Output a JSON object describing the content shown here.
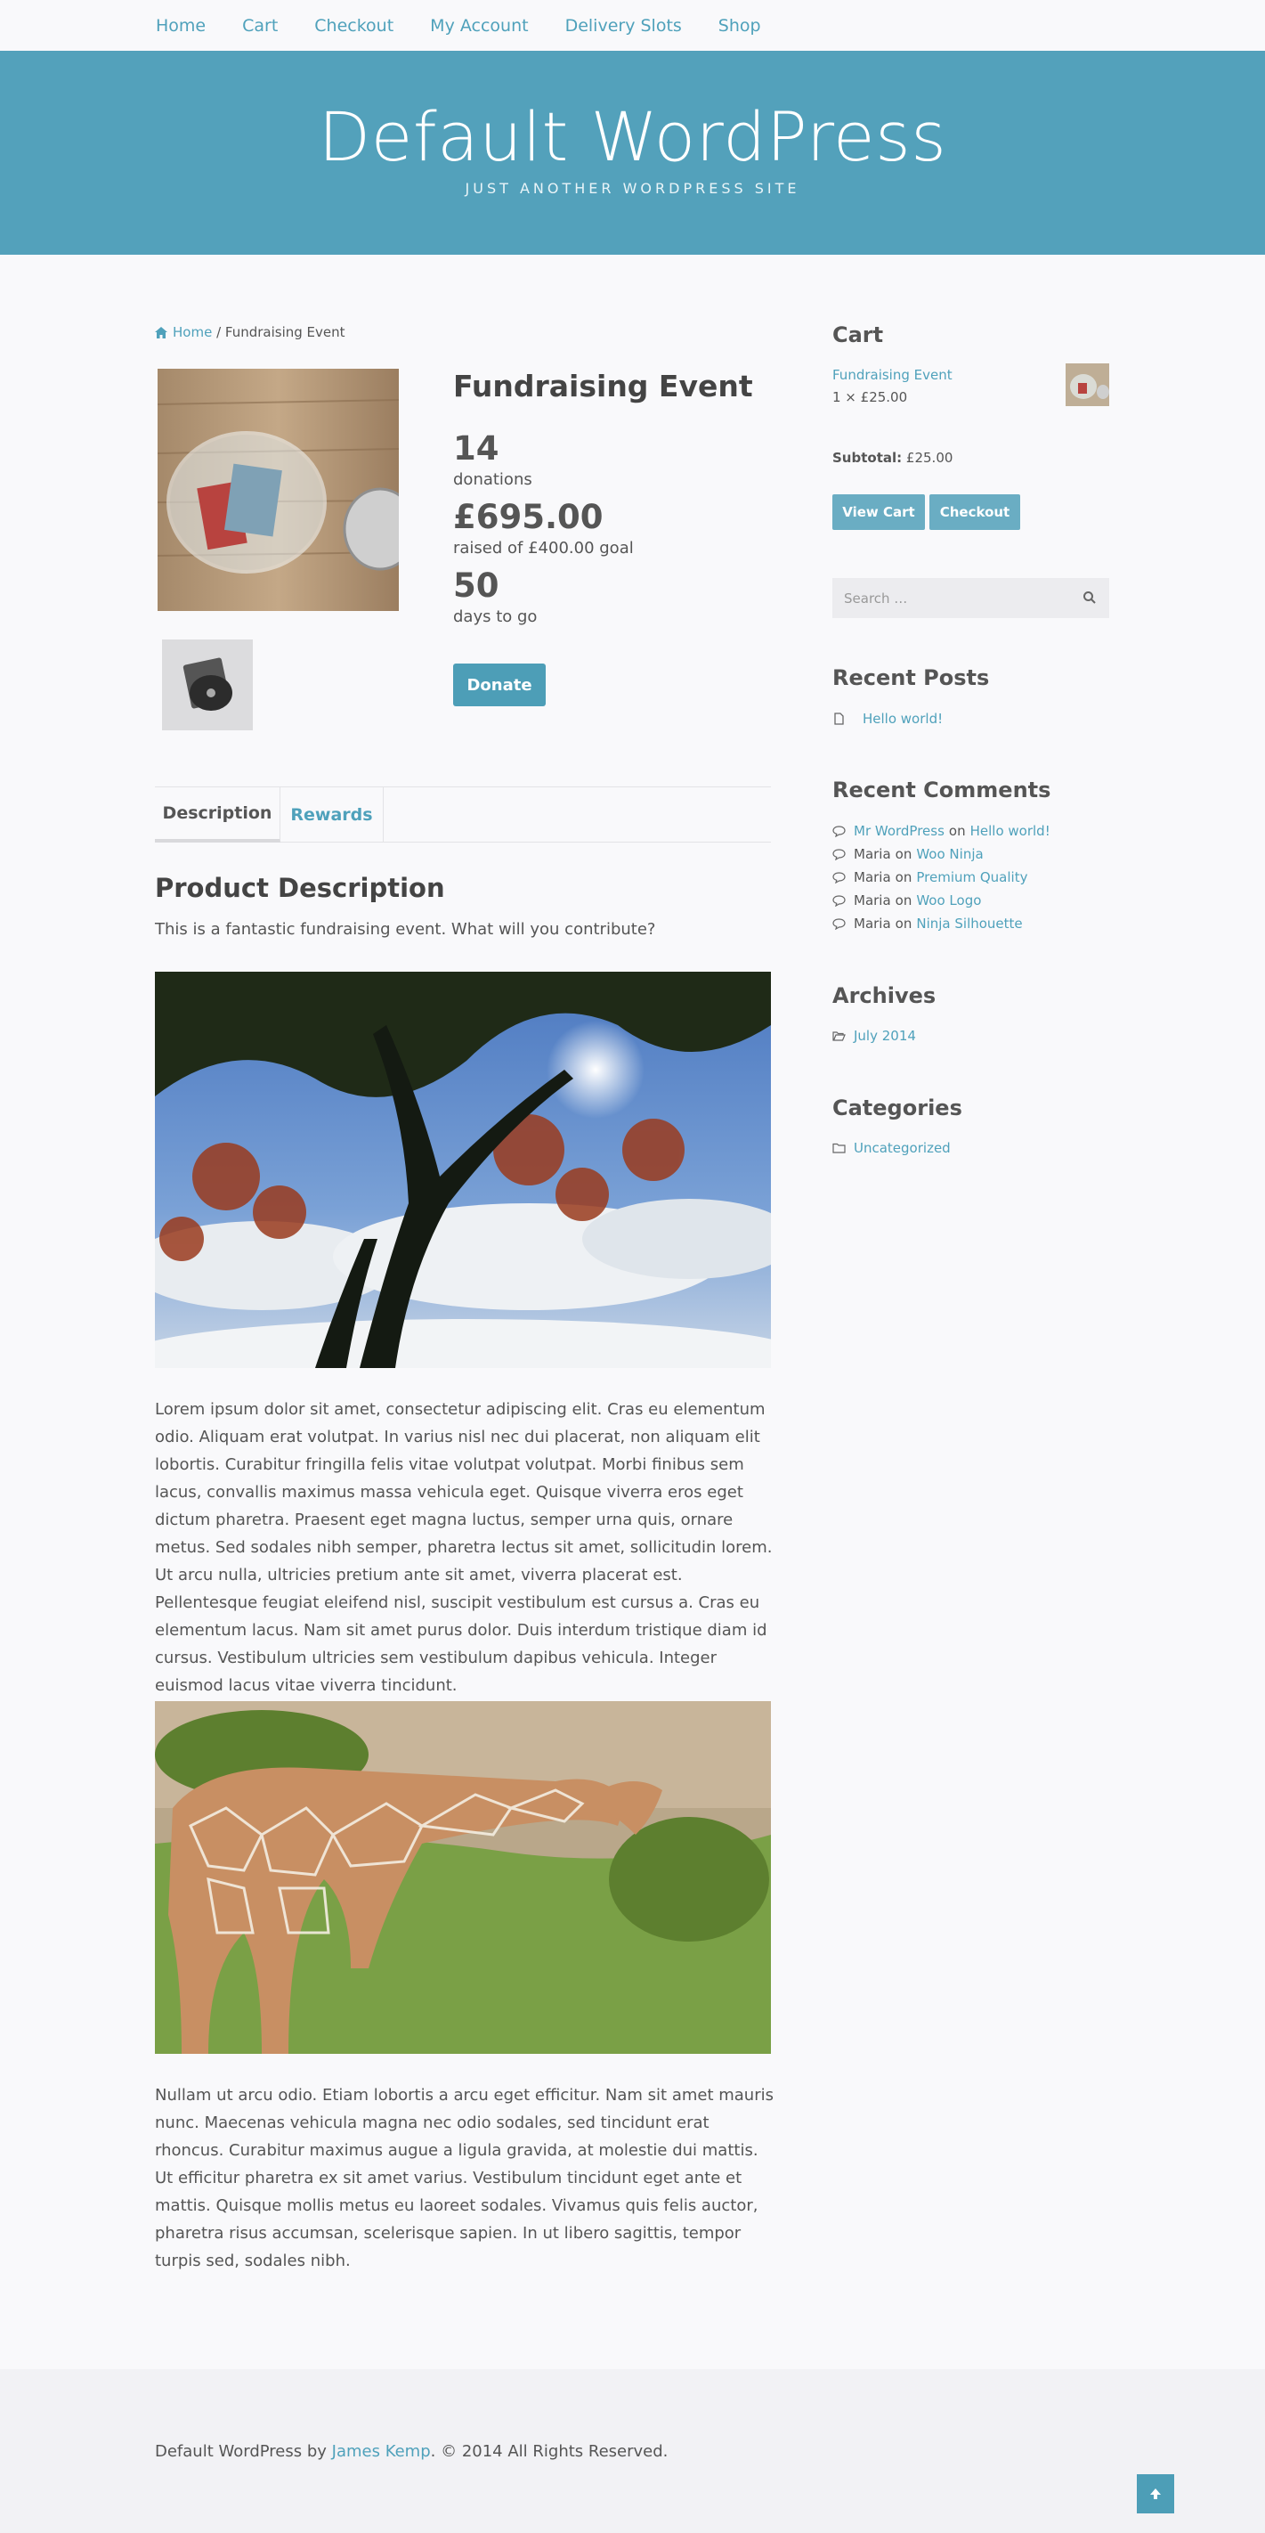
{
  "nav": {
    "items": [
      {
        "label": "Home"
      },
      {
        "label": "Cart"
      },
      {
        "label": "Checkout"
      },
      {
        "label": "My Account"
      },
      {
        "label": "Delivery Slots"
      },
      {
        "label": "Shop"
      }
    ]
  },
  "header": {
    "site_title": "Default WordPress",
    "tagline": "JUST ANOTHER WORDPRESS SITE"
  },
  "breadcrumb": {
    "home": "Home",
    "separator": " / ",
    "current": "Fundraising Event"
  },
  "product": {
    "title": "Fundraising Event",
    "donations_count": "14",
    "donations_label": "donations",
    "raised_amount": "£695.00",
    "raised_label": "raised of £400.00 goal",
    "days_count": "50",
    "days_label": "days to go",
    "donate_label": "Donate"
  },
  "tabs": [
    {
      "label": "Description",
      "active": true
    },
    {
      "label": "Rewards",
      "active": false
    }
  ],
  "description": {
    "heading": "Product Description",
    "intro": "This is a fantastic fundraising event. What will you contribute?",
    "paragraph1": "Lorem ipsum dolor sit amet, consectetur adipiscing elit. Cras eu elementum odio. Aliquam erat volutpat. In varius nisl nec dui placerat, non aliquam elit lobortis. Curabitur fringilla felis vitae volutpat volutpat. Morbi finibus sem lacus, convallis maximus massa vehicula eget. Quisque viverra eros eget dictum pharetra. Praesent eget magna luctus, semper urna quis, ornare metus. Sed sodales nibh semper, pharetra lectus sit amet, sollicitudin lorem. Ut arcu nulla, ultricies pretium ante sit amet, viverra placerat est. Pellentesque feugiat eleifend nisl, suscipit vestibulum est cursus a. Cras eu elementum lacus. Nam sit amet purus dolor. Duis interdum tristique diam id cursus. Vestibulum ultricies sem vestibulum dapibus vehicula. Integer euismod lacus vitae viverra tincidunt.",
    "paragraph2": "Nullam ut arcu odio. Etiam lobortis a arcu eget efficitur. Nam sit amet mauris nunc. Maecenas vehicula magna nec odio sodales, sed tincidunt erat rhoncus. Curabitur maximus augue a ligula gravida, at molestie dui mattis. Ut efficitur pharetra ex sit amet varius. Vestibulum tincidunt eget ante et mattis. Quisque mollis metus eu laoreet sodales. Vivamus quis felis auctor, pharetra risus accumsan, scelerisque sapien. In ut libero sagittis, tempor turpis sed, sodales nibh."
  },
  "sidebar": {
    "cart": {
      "heading": "Cart",
      "item_name": "Fundraising Event",
      "item_qty": "1 × £25.00",
      "subtotal_label": "Subtotal:",
      "subtotal_value": "£25.00",
      "view_cart": "View Cart",
      "checkout": "Checkout"
    },
    "search": {
      "placeholder": "Search …"
    },
    "recent_posts": {
      "heading": "Recent Posts",
      "items": [
        {
          "label": "Hello world!"
        }
      ]
    },
    "recent_comments": {
      "heading": "Recent Comments",
      "on_word": "on",
      "items": [
        {
          "author": "Mr WordPress",
          "author_link": true,
          "post": "Hello world!"
        },
        {
          "author": "Maria",
          "author_link": false,
          "post": "Woo Ninja"
        },
        {
          "author": "Maria",
          "author_link": false,
          "post": "Premium Quality"
        },
        {
          "author": "Maria",
          "author_link": false,
          "post": "Woo Logo"
        },
        {
          "author": "Maria",
          "author_link": false,
          "post": "Ninja Silhouette"
        }
      ]
    },
    "archives": {
      "heading": "Archives",
      "items": [
        {
          "label": "July 2014"
        }
      ]
    },
    "categories": {
      "heading": "Categories",
      "items": [
        {
          "label": "Uncategorized"
        }
      ]
    }
  },
  "footer": {
    "prefix": "Default WordPress by ",
    "author": "James Kemp",
    "suffix": ". © 2014 All Rights Reserved."
  },
  "colors": {
    "accent": "#4fa1bb",
    "header_bg": "#53a1bb",
    "page_bg": "#f9f9fb"
  }
}
